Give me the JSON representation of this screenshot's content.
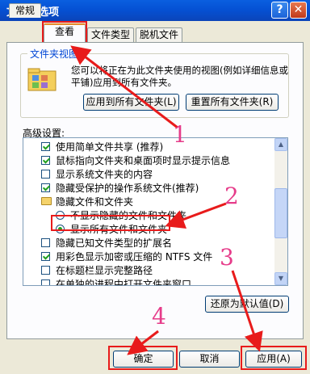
{
  "window": {
    "title": "文件夹选项",
    "help_label": "?",
    "close_label": "✕"
  },
  "tabs": [
    {
      "label": "常规"
    },
    {
      "label": "查看"
    },
    {
      "label": "文件类型"
    },
    {
      "label": "脱机文件"
    }
  ],
  "folder_views": {
    "title": "文件夹视图",
    "icon": "folder-view-icon",
    "description": "您可以将正在为此文件夹使用的视图(例如详细信息或平铺)应用到所有文件夹。",
    "apply_all_label": "应用到所有文件夹(L)",
    "reset_all_label": "重置所有文件夹(R)"
  },
  "advanced": {
    "label": "高级设置:",
    "items": [
      {
        "type": "checkbox",
        "checked": true,
        "label": "使用简单文件共享 (推荐)"
      },
      {
        "type": "checkbox",
        "checked": true,
        "label": "鼠标指向文件夹和桌面项时显示提示信息"
      },
      {
        "type": "checkbox",
        "checked": false,
        "label": "显示系统文件夹的内容"
      },
      {
        "type": "checkbox",
        "checked": true,
        "label": "隐藏受保护的操作系统文件(推荐)"
      },
      {
        "type": "folder",
        "label": "隐藏文件和文件夹"
      },
      {
        "type": "radio",
        "checked": false,
        "label": "不显示隐藏的文件和文件夹"
      },
      {
        "type": "radio",
        "checked": true,
        "label": "显示所有文件和文件夹"
      },
      {
        "type": "checkbox",
        "checked": false,
        "label": "隐藏已知文件类型的扩展名"
      },
      {
        "type": "checkbox",
        "checked": true,
        "label": "用彩色显示加密或压缩的 NTFS 文件"
      },
      {
        "type": "checkbox",
        "checked": false,
        "label": "在标题栏显示完整路径"
      },
      {
        "type": "checkbox",
        "checked": false,
        "label": "在单独的进程中打开文件夹窗口"
      }
    ]
  },
  "restore_defaults_label": "还原为默认值(D)",
  "footer": {
    "ok_label": "确定",
    "cancel_label": "取消",
    "apply_label": "应用(A)"
  },
  "annotations": {
    "n1": "1",
    "n2": "2",
    "n3": "3",
    "n4": "4",
    "color": "#e63c8a",
    "box_color": "#e81b1b"
  }
}
